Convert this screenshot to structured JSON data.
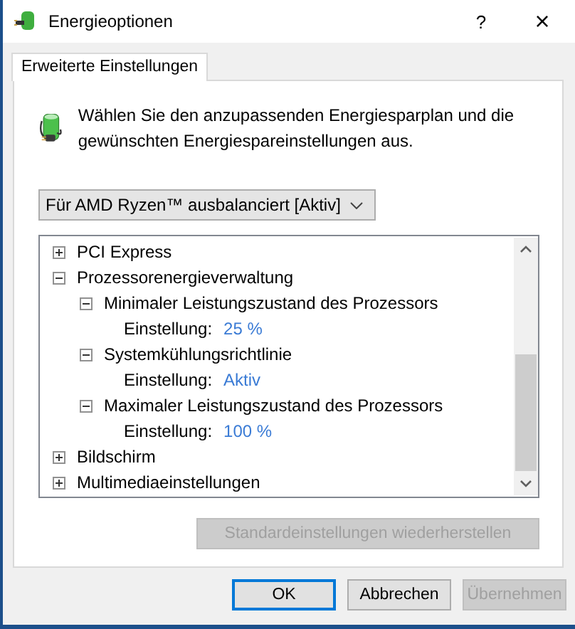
{
  "window": {
    "title": "Energieoptionen",
    "help": "?",
    "close": "×"
  },
  "tabs": [
    {
      "label": "Erweiterte Einstellungen",
      "selected": true
    }
  ],
  "description": "Wählen Sie den anzupassenden Energiesparplan und die gewünschten Energiespareinstellungen aus.",
  "plan_select": {
    "value": "Für AMD Ryzen™ ausbalanciert [Aktiv]"
  },
  "tree": [
    {
      "label": "PCI Express",
      "expanded": false
    },
    {
      "label": "Prozessorenergieverwaltung",
      "expanded": true,
      "children": [
        {
          "label": "Minimaler Leistungszustand des Prozessors",
          "expanded": true,
          "setting": {
            "label": "Einstellung:",
            "value": "25 %"
          }
        },
        {
          "label": "Systemkühlungsrichtlinie",
          "expanded": true,
          "setting": {
            "label": "Einstellung:",
            "value": "Aktiv"
          }
        },
        {
          "label": "Maximaler Leistungszustand des Prozessors",
          "expanded": true,
          "setting": {
            "label": "Einstellung:",
            "value": "100 %"
          }
        }
      ]
    },
    {
      "label": "Bildschirm",
      "expanded": false
    },
    {
      "label": "Multimediaeinstellungen",
      "expanded": false
    }
  ],
  "restore_button": {
    "label": "Standardeinstellungen wiederherstellen",
    "disabled": true
  },
  "buttons": [
    {
      "label": "OK",
      "default": true,
      "disabled": false
    },
    {
      "label": "Abbrechen",
      "default": false,
      "disabled": false
    },
    {
      "label": "Übernehmen",
      "default": false,
      "disabled": true
    }
  ]
}
